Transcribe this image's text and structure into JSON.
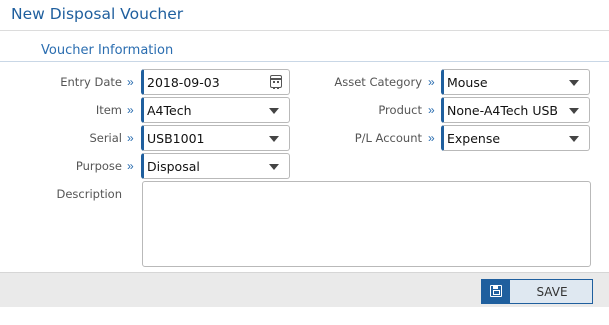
{
  "header": {
    "title": "New Disposal Voucher"
  },
  "section": {
    "title": "Voucher Information"
  },
  "form": {
    "entry_date": {
      "label": "Entry Date",
      "value": "2018-09-03"
    },
    "item": {
      "label": "Item",
      "value": "A4Tech"
    },
    "serial": {
      "label": "Serial",
      "value": "USB1001"
    },
    "purpose": {
      "label": "Purpose",
      "value": "Disposal"
    },
    "description": {
      "label": "Description",
      "value": ""
    },
    "asset_category": {
      "label": "Asset Category",
      "value": "Mouse"
    },
    "product": {
      "label": "Product",
      "value": "None-A4Tech USB"
    },
    "pl_account": {
      "label": "P/L Account",
      "value": "Expense"
    }
  },
  "footer": {
    "save_label": "SAVE"
  },
  "colors": {
    "accent": "#1f5f9e",
    "footer_bg": "#eaeaea"
  },
  "icons": {
    "chevron": "double-chevron-right-icon",
    "calendar": "calendar-icon",
    "dropdown": "caret-down-icon",
    "save": "floppy-disk-icon"
  }
}
